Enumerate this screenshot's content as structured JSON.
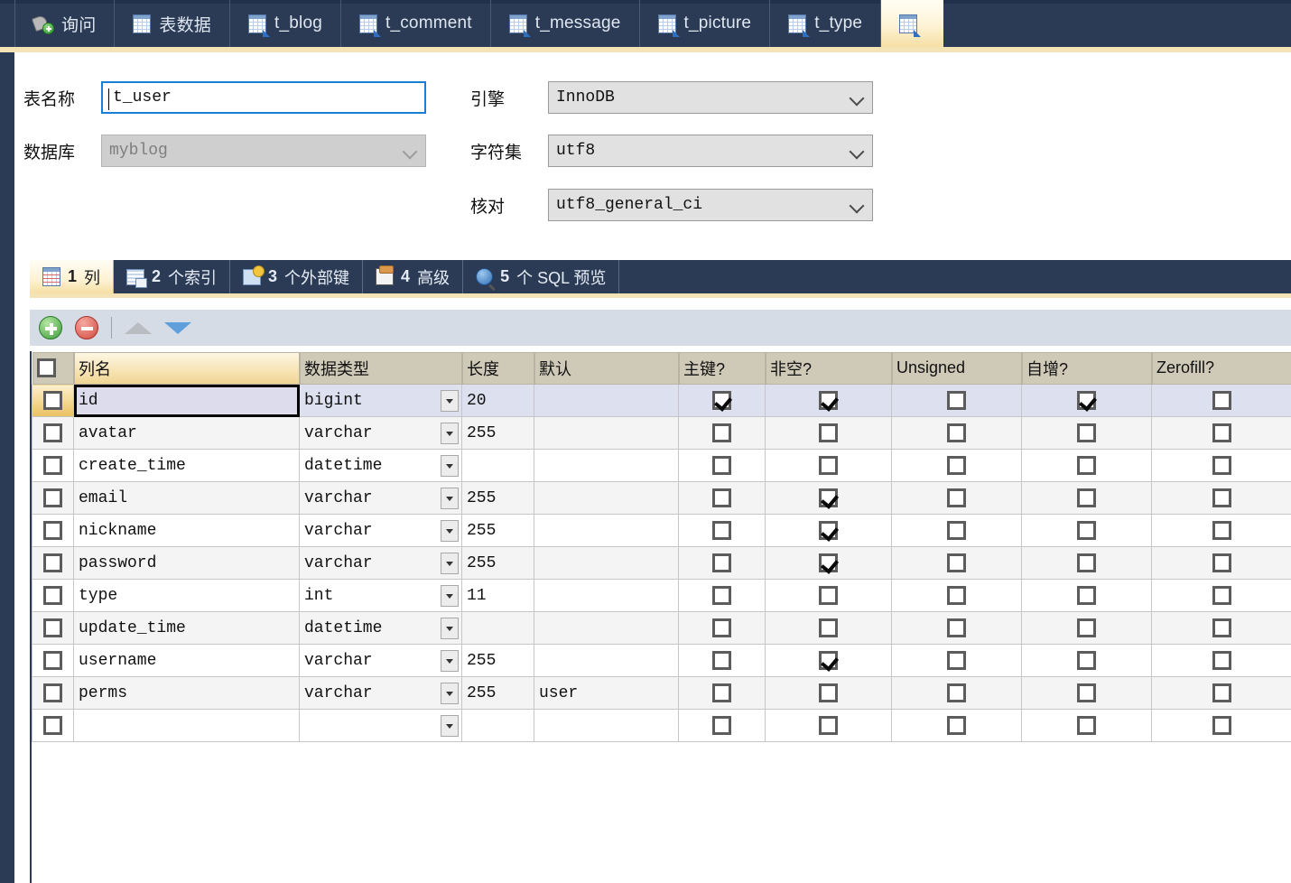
{
  "window": {
    "top_tabs": [
      {
        "label": "询问",
        "icon": "query-plus-icon",
        "active": false
      },
      {
        "label": "表数据",
        "icon": "table-icon",
        "active": false
      },
      {
        "label": "t_blog",
        "icon": "table-edit-icon",
        "active": false
      },
      {
        "label": "t_comment",
        "icon": "table-edit-icon",
        "active": false
      },
      {
        "label": "t_message",
        "icon": "table-edit-icon",
        "active": false
      },
      {
        "label": "t_picture",
        "icon": "table-edit-icon",
        "active": false
      },
      {
        "label": "t_type",
        "icon": "table-edit-icon",
        "active": false
      },
      {
        "label": "",
        "icon": "table-edit-icon",
        "active": true
      }
    ]
  },
  "form": {
    "table_name_label": "表名称",
    "table_name_value": "t_user",
    "database_label": "数据库",
    "database_value": "myblog",
    "engine_label": "引擎",
    "engine_value": "InnoDB",
    "charset_label": "字符集",
    "charset_value": "utf8",
    "collation_label": "核对",
    "collation_value": "utf8_general_ci"
  },
  "inner_tabs": [
    {
      "num": "1",
      "label": "列",
      "icon": "columns-icon",
      "active": true
    },
    {
      "num": "2",
      "label": "个索引",
      "icon": "index-icon",
      "active": false
    },
    {
      "num": "3",
      "label": "个外部键",
      "icon": "foreign-key-icon",
      "active": false
    },
    {
      "num": "4",
      "label": "高级",
      "icon": "advanced-icon",
      "active": false
    },
    {
      "num": "5",
      "label": "个 SQL 预览",
      "icon": "sql-preview-icon",
      "active": false
    }
  ],
  "toolbar": {
    "add_label": "添加栏位",
    "delete_label": "删除栏位",
    "move_up_label": "上移",
    "move_down_label": "下移"
  },
  "grid": {
    "headers": [
      "",
      "列名",
      "数据类型",
      "长度",
      "默认",
      "主键?",
      "非空?",
      "Unsigned",
      "自增?",
      "Zerofill?"
    ],
    "sorted_header_index": 1,
    "rows": [
      {
        "name": "id",
        "type": "bigint",
        "length": "20",
        "default": "",
        "pk": true,
        "notnull": true,
        "unsigned": false,
        "autoinc": true,
        "zerofill": false,
        "selected": true
      },
      {
        "name": "avatar",
        "type": "varchar",
        "length": "255",
        "default": "",
        "pk": false,
        "notnull": false,
        "unsigned": false,
        "autoinc": false,
        "zerofill": false,
        "selected": false
      },
      {
        "name": "create_time",
        "type": "datetime",
        "length": "",
        "default": "",
        "pk": false,
        "notnull": false,
        "unsigned": false,
        "autoinc": false,
        "zerofill": false,
        "selected": false
      },
      {
        "name": "email",
        "type": "varchar",
        "length": "255",
        "default": "",
        "pk": false,
        "notnull": true,
        "unsigned": false,
        "autoinc": false,
        "zerofill": false,
        "selected": false
      },
      {
        "name": "nickname",
        "type": "varchar",
        "length": "255",
        "default": "",
        "pk": false,
        "notnull": true,
        "unsigned": false,
        "autoinc": false,
        "zerofill": false,
        "selected": false
      },
      {
        "name": "password",
        "type": "varchar",
        "length": "255",
        "default": "",
        "pk": false,
        "notnull": true,
        "unsigned": false,
        "autoinc": false,
        "zerofill": false,
        "selected": false
      },
      {
        "name": "type",
        "type": "int",
        "length": "11",
        "default": "",
        "pk": false,
        "notnull": false,
        "unsigned": false,
        "autoinc": false,
        "zerofill": false,
        "selected": false
      },
      {
        "name": "update_time",
        "type": "datetime",
        "length": "",
        "default": "",
        "pk": false,
        "notnull": false,
        "unsigned": false,
        "autoinc": false,
        "zerofill": false,
        "selected": false
      },
      {
        "name": "username",
        "type": "varchar",
        "length": "255",
        "default": "",
        "pk": false,
        "notnull": true,
        "unsigned": false,
        "autoinc": false,
        "zerofill": false,
        "selected": false
      },
      {
        "name": "perms",
        "type": "varchar",
        "length": "255",
        "default": "user",
        "pk": false,
        "notnull": false,
        "unsigned": false,
        "autoinc": false,
        "zerofill": false,
        "selected": false
      },
      {
        "name": "",
        "type": "",
        "length": "",
        "default": "",
        "pk": false,
        "notnull": false,
        "unsigned": false,
        "autoinc": false,
        "zerofill": false,
        "selected": false
      }
    ]
  },
  "colors": {
    "chrome_dark": "#2b3b55",
    "active_tab": "#f6dfa4",
    "header_tan": "#cfc9b8",
    "selected_row": "#dde0ee",
    "toolbar_bg": "#d5dce5"
  }
}
